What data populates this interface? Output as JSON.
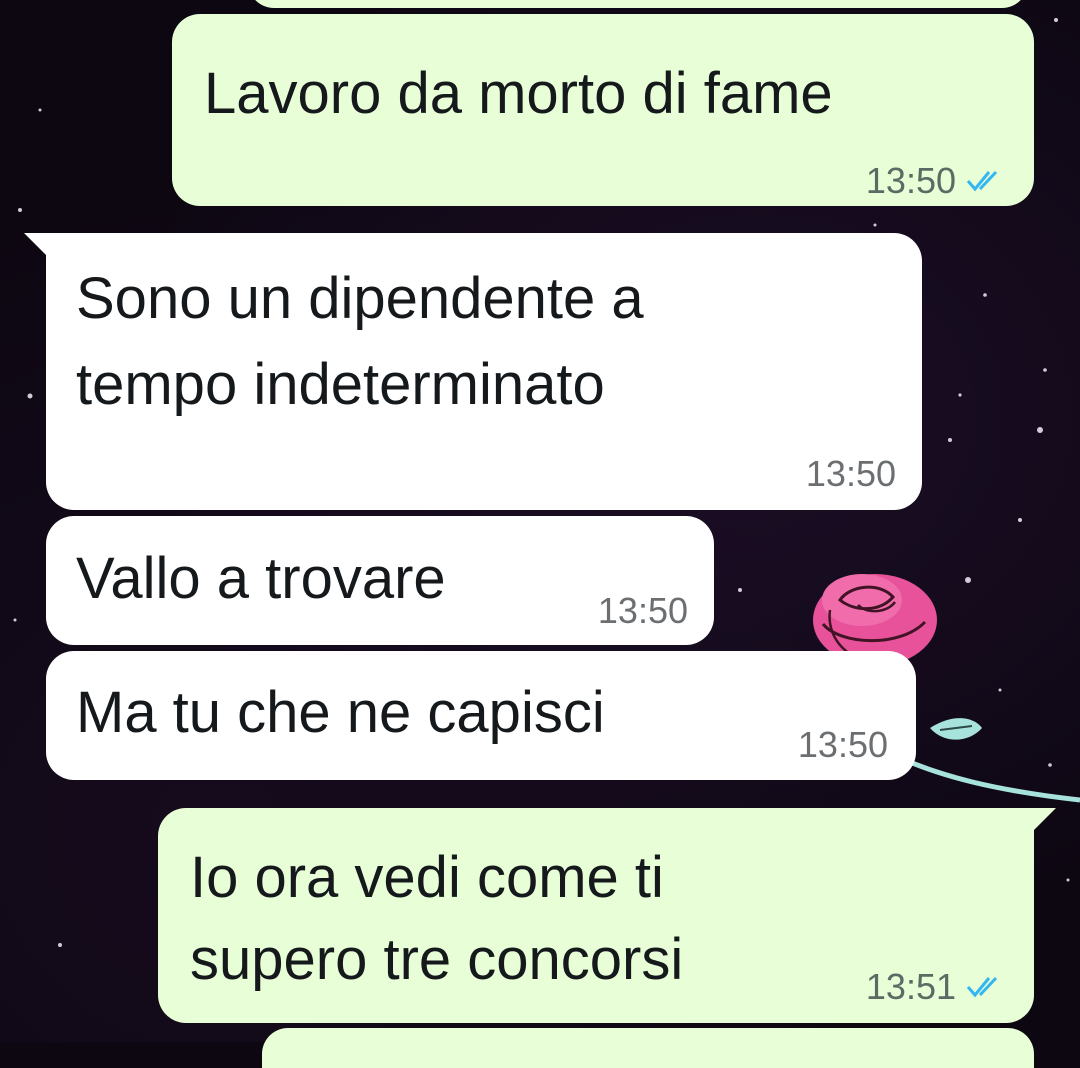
{
  "messages": [
    {
      "direction": "outgoing",
      "text_lines": [
        "Lavoro da morto di fame"
      ],
      "time": "13:50",
      "status": "read-double-check"
    },
    {
      "direction": "incoming",
      "text_lines": [
        "Sono un dipendente a",
        "tempo indeterminato"
      ],
      "time": "13:50"
    },
    {
      "direction": "incoming",
      "text_lines": [
        "Vallo a trovare"
      ],
      "time": "13:50"
    },
    {
      "direction": "incoming",
      "text_lines": [
        "Ma tu che ne capisci"
      ],
      "time": "13:50"
    },
    {
      "direction": "outgoing",
      "text_lines": [
        "Io ora vedi come ti",
        "supero tre concorsi"
      ],
      "time": "13:51",
      "status": "read-double-check"
    }
  ],
  "colors": {
    "outgoing_bubble": "#e7fed7",
    "incoming_bubble": "#ffffff",
    "wallpaper": "#0d0712",
    "read_check": "#34b7f1",
    "rose": "#e8529a",
    "stem": "#a7e3dc"
  },
  "icons": {
    "read_status": "double-check-icon",
    "wallpaper_decoration": "rose-icon"
  }
}
